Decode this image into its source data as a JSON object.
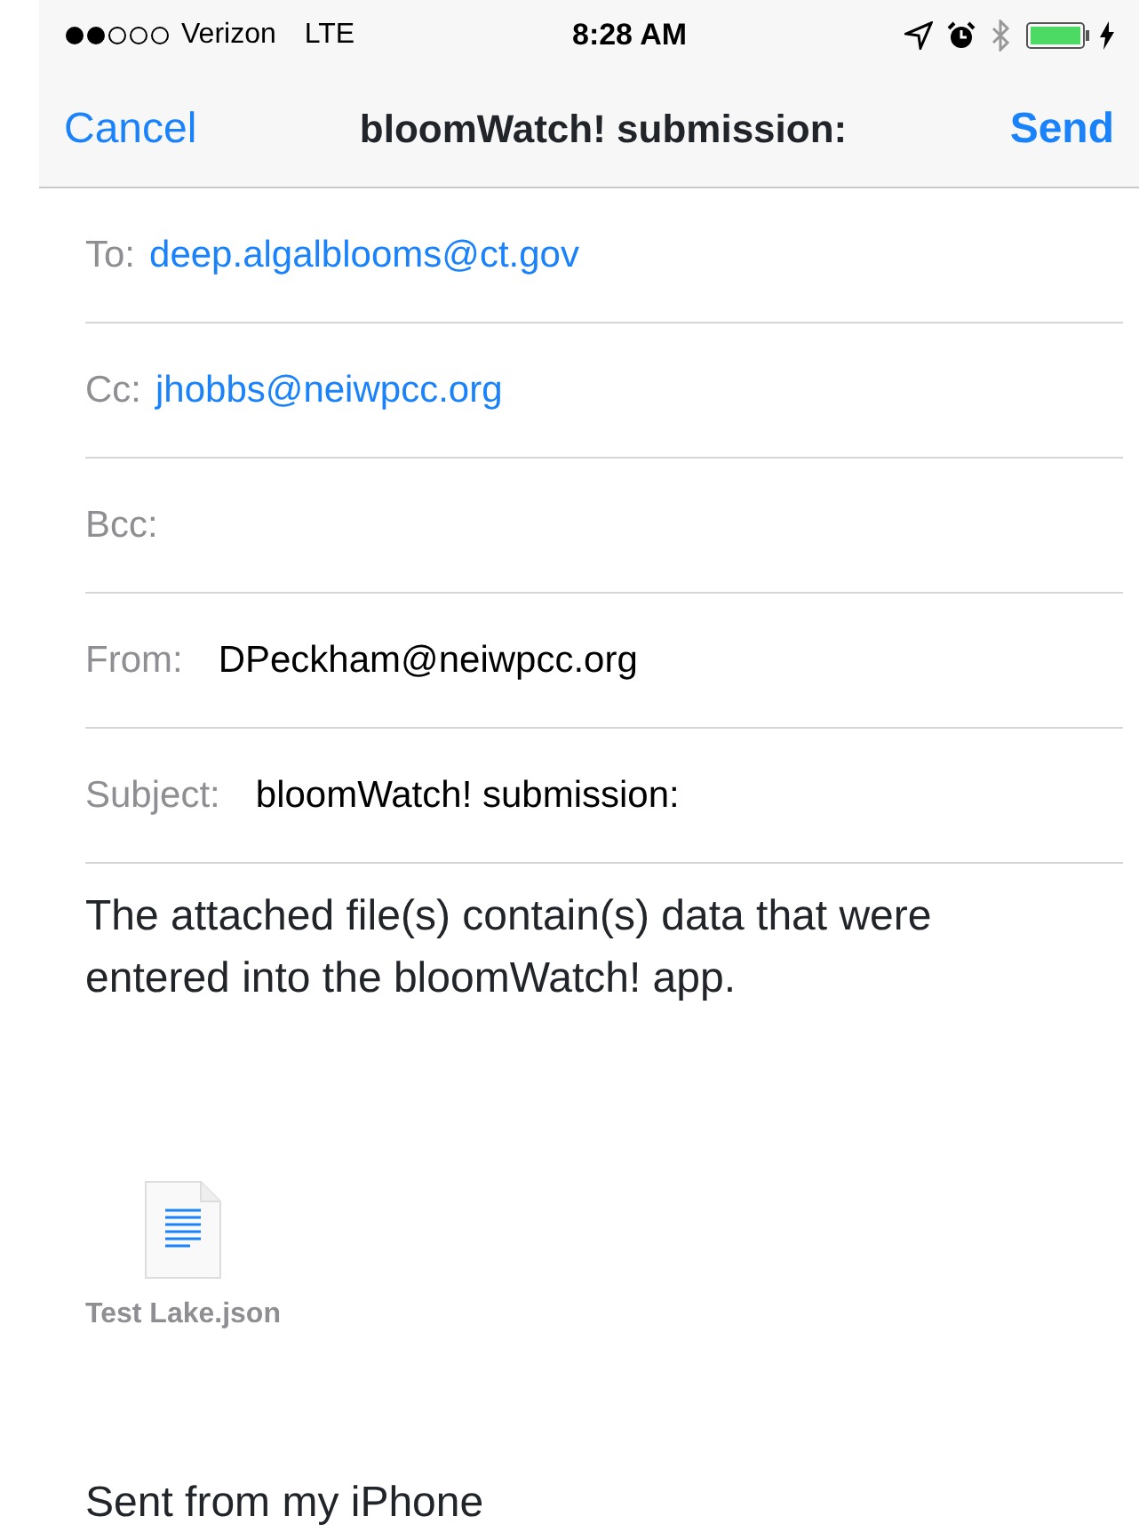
{
  "status_bar": {
    "carrier": "Verizon",
    "network": "LTE",
    "time": "8:28 AM"
  },
  "nav": {
    "cancel": "Cancel",
    "title": "bloomWatch! submission:",
    "send": "Send"
  },
  "fields": [
    {
      "label": "To:",
      "value": "deep.algalblooms@ct.gov",
      "kind": "address"
    },
    {
      "label": "Cc:",
      "value": "jhobbs@neiwpcc.org",
      "kind": "address"
    },
    {
      "label": "Bcc:",
      "kind": "address"
    },
    {
      "label": "From:",
      "value": "DPeckham@neiwpcc.org",
      "kind": "plain"
    },
    {
      "label": "Subject:",
      "value": "bloomWatch! submission:",
      "kind": "plain"
    }
  ],
  "body": {
    "text": "The attached file(s) contain(s) data that were entered into the bloomWatch! app.",
    "attachment": "Test Lake.json",
    "signature": "Sent from my iPhone"
  }
}
